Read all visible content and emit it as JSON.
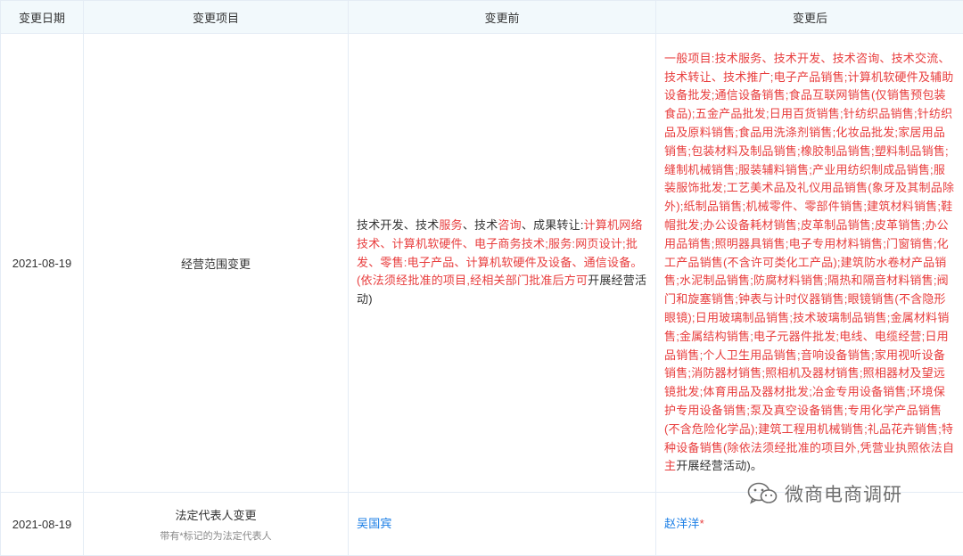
{
  "table": {
    "headers": [
      "变更日期",
      "变更项目",
      "变更前",
      "变更后"
    ],
    "rows": [
      {
        "date": "2021-08-19",
        "item": "经营范围变更",
        "before_parts": [
          {
            "text": "技术开发、技术",
            "highlight": false
          },
          {
            "text": "服务",
            "highlight": true
          },
          {
            "text": "、技术",
            "highlight": false
          },
          {
            "text": "咨询",
            "highlight": true
          },
          {
            "text": "、成果转让:",
            "highlight": false
          },
          {
            "text": "计算机网络技术、计算机软硬件、电子商务技术;服务:网页设计;批发、零售:电子产品、计算机软硬件及设备、通信设备。(依法须经批准的项目,经相关部门批准后方可",
            "highlight": true
          },
          {
            "text": "开展经营活动)",
            "highlight": false
          }
        ],
        "after_parts": [
          {
            "text": "一般项目:技术服务、技术开发、技术咨询、技术交流、技术转让、技术推广;电子产品销售;计算机软硬件及辅助设备批发;通信设备销售;食品互联网销售(仅销售预包装食品);五金产品批发;日用百货销售;针纺织品销售;针纺织品及原料销售;食品用洗涤剂销售;化妆品批发;家居用品销售;包装材料及制品销售;橡胶制品销售;塑料制品销售;缝制机械销售;服装辅料销售;产业用纺织制成品销售;服装服饰批发;工艺美术品及礼仪用品销售(象牙及其制品除外);纸制品销售;机械零件、零部件销售;建筑材料销售;鞋帽批发;办公设备耗材销售;皮革制品销售;皮革销售;办公用品销售;照明器具销售;电子专用材料销售;门窗销售;化工产品销售(不含许可类化工产品);建筑防水卷材产品销售;水泥制品销售;防腐材料销售;隔热和隔音材料销售;阀门和旋塞销售;钟表与计时仪器销售;眼镜销售(不含隐形眼镜);日用玻璃制品销售;技术玻璃制品销售;金属材料销售;金属结构销售;电子元器件批发;电线、电缆经营;日用品销售;个人卫生用品销售;音响设备销售;家用视听设备销售;消防器材销售;照相机及器材销售;照相器材及望远镜批发;体育用品及器材批发;冶金专用设备销售;环境保护专用设备销售;泵及真空设备销售;专用化学产品销售(不含危险化学品);建筑工程用机械销售;礼品花卉销售;特种设备销售(除依法须经批准的项目外,凭营业执照依法自主",
            "highlight": true
          },
          {
            "text": "开展经营活动)。",
            "highlight": false
          }
        ]
      },
      {
        "date": "2021-08-19",
        "item": "法定代表人变更",
        "item_note": "带有*标记的为法定代表人",
        "before_parts": [
          {
            "text": "吴国宾",
            "link": true
          }
        ],
        "after_parts": [
          {
            "text": "赵洋洋",
            "link": true
          },
          {
            "text": "*",
            "highlight": true
          }
        ]
      }
    ]
  },
  "watermark": {
    "text": "微商电商调研",
    "icon": "wechat-icon"
  },
  "colors": {
    "header_bg": "#f2f9fc",
    "border": "#e4ecf5",
    "highlight": "#e83d3d",
    "link": "#1a7ee6"
  }
}
